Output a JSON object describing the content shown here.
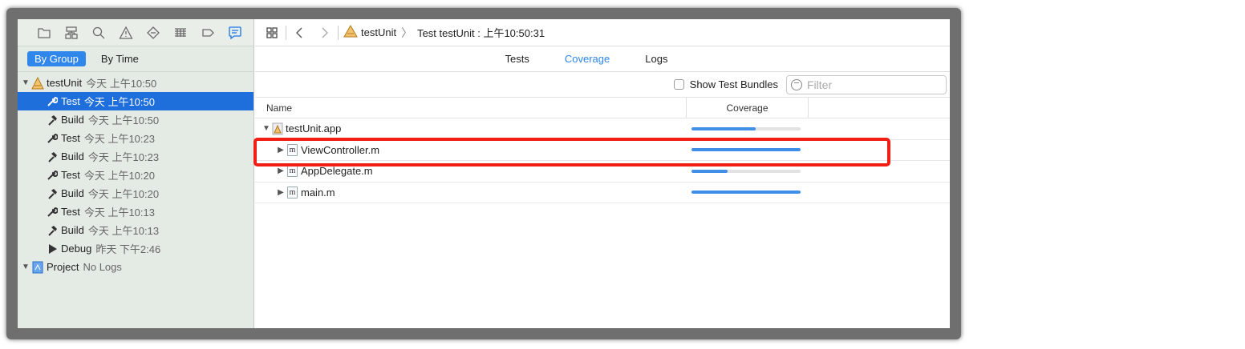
{
  "sidebar": {
    "nav_icons": [
      "folder-icon",
      "hierarchy-icon",
      "search-icon",
      "warning-icon",
      "test-icon",
      "debug-icon",
      "breakpoint-icon",
      "report-icon"
    ],
    "segments": [
      {
        "label": "By Group",
        "active": true
      },
      {
        "label": "By Time",
        "active": false
      }
    ],
    "tree": {
      "group": {
        "name": "testUnit",
        "when": "今天 上午10:50"
      },
      "items": [
        {
          "name": "Test",
          "when": "今天 上午10:50",
          "icon": "wrench-icon",
          "selected": true
        },
        {
          "name": "Build",
          "when": "今天 上午10:50",
          "icon": "hammer-icon"
        },
        {
          "name": "Test",
          "when": "今天 上午10:23",
          "icon": "wrench-icon"
        },
        {
          "name": "Build",
          "when": "今天 上午10:23",
          "icon": "hammer-icon"
        },
        {
          "name": "Test",
          "when": "今天 上午10:20",
          "icon": "wrench-icon"
        },
        {
          "name": "Build",
          "when": "今天 上午10:20",
          "icon": "hammer-icon"
        },
        {
          "name": "Test",
          "when": "今天 上午10:13",
          "icon": "wrench-icon"
        },
        {
          "name": "Build",
          "when": "今天 上午10:13",
          "icon": "hammer-icon"
        },
        {
          "name": "Debug",
          "when": "昨天 下午2:46",
          "icon": "play-icon"
        }
      ],
      "project": {
        "name": "Project",
        "when": "No Logs"
      }
    }
  },
  "toolbar": {
    "breadcrumb_app": "testUnit",
    "breadcrumb_item": "Test testUnit : 上午10:50:31"
  },
  "tabs": [
    {
      "label": "Tests",
      "active": false
    },
    {
      "label": "Coverage",
      "active": true
    },
    {
      "label": "Logs",
      "active": false
    }
  ],
  "filterbar": {
    "show_bundles_label": "Show Test Bundles",
    "filter_placeholder": "Filter"
  },
  "table": {
    "columns": {
      "name": "Name",
      "coverage": "Coverage"
    },
    "rows": [
      {
        "name": "testUnit.app",
        "coverage": 0.59,
        "kind": "app",
        "expanded": true
      },
      {
        "name": "ViewController.m",
        "coverage": 1.0,
        "kind": "m"
      },
      {
        "name": "AppDelegate.m",
        "coverage": 0.33,
        "kind": "m"
      },
      {
        "name": "main.m",
        "coverage": 1.0,
        "kind": "m"
      }
    ]
  },
  "colors": {
    "accent": "#2f86eb",
    "selection": "#1e6fdb",
    "coverage_bar": "#3f8fe6",
    "highlight": "#f01e14"
  }
}
